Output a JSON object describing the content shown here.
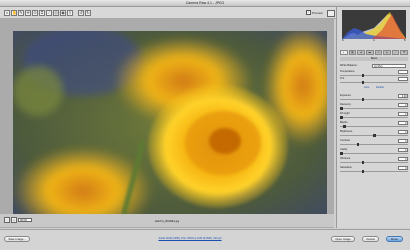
{
  "window": {
    "title": "Camera Raw 4.1 - JPEG"
  },
  "toolbar": {
    "tools": [
      {
        "name": "zoom-tool-icon",
        "glyph": "⌕"
      },
      {
        "name": "hand-tool-icon",
        "glyph": "✋"
      },
      {
        "name": "white-balance-tool-icon",
        "glyph": "✎"
      },
      {
        "name": "color-sampler-icon",
        "glyph": "✛"
      },
      {
        "name": "targeted-adjustment-icon",
        "glyph": "⊙"
      },
      {
        "name": "crop-tool-icon",
        "glyph": "⌗"
      },
      {
        "name": "straighten-tool-icon",
        "glyph": "⟋"
      },
      {
        "name": "spot-removal-icon",
        "glyph": "◎"
      },
      {
        "name": "red-eye-icon",
        "glyph": "◉"
      },
      {
        "name": "preferences-icon",
        "glyph": "≡"
      },
      {
        "name": "rotate-left-icon",
        "glyph": "↺"
      },
      {
        "name": "rotate-right-icon",
        "glyph": "↻"
      }
    ],
    "preview_label": "Preview"
  },
  "canvas": {
    "zoom_minus": "-",
    "zoom_plus": "+",
    "zoom_value": "38.6%",
    "filename": "Helichry_B61BE1.jpg"
  },
  "panel": {
    "section_title": "Basic",
    "white_balance": {
      "label": "White Balance:",
      "value": "As Shot"
    },
    "auto_label": "Auto",
    "default_label": "Default",
    "sliders": [
      {
        "label": "Temperature",
        "value": ""
      },
      {
        "label": "Tint",
        "value": ""
      },
      {
        "label": "Exposure",
        "value": "0.00"
      },
      {
        "label": "Recovery",
        "value": "0"
      },
      {
        "label": "Fill Light",
        "value": "0"
      },
      {
        "label": "Blacks",
        "value": "0"
      },
      {
        "label": "Brightness",
        "value": "0"
      },
      {
        "label": "Contrast",
        "value": "0"
      },
      {
        "label": "Clarity",
        "value": "0"
      },
      {
        "label": "Vibrance",
        "value": "0"
      },
      {
        "label": "Saturation",
        "value": "0"
      }
    ]
  },
  "footer": {
    "save_label": "Save Image...",
    "workflow": "Adobe RGB (1998); 8 bit; 3504 by 2336 (8.2MP); 240 ppi",
    "open_label": "Open Image",
    "cancel_label": "Cancel",
    "done_label": "Done"
  },
  "colors": {
    "accent": "#6aa4e0",
    "link": "#1c4fb0"
  }
}
